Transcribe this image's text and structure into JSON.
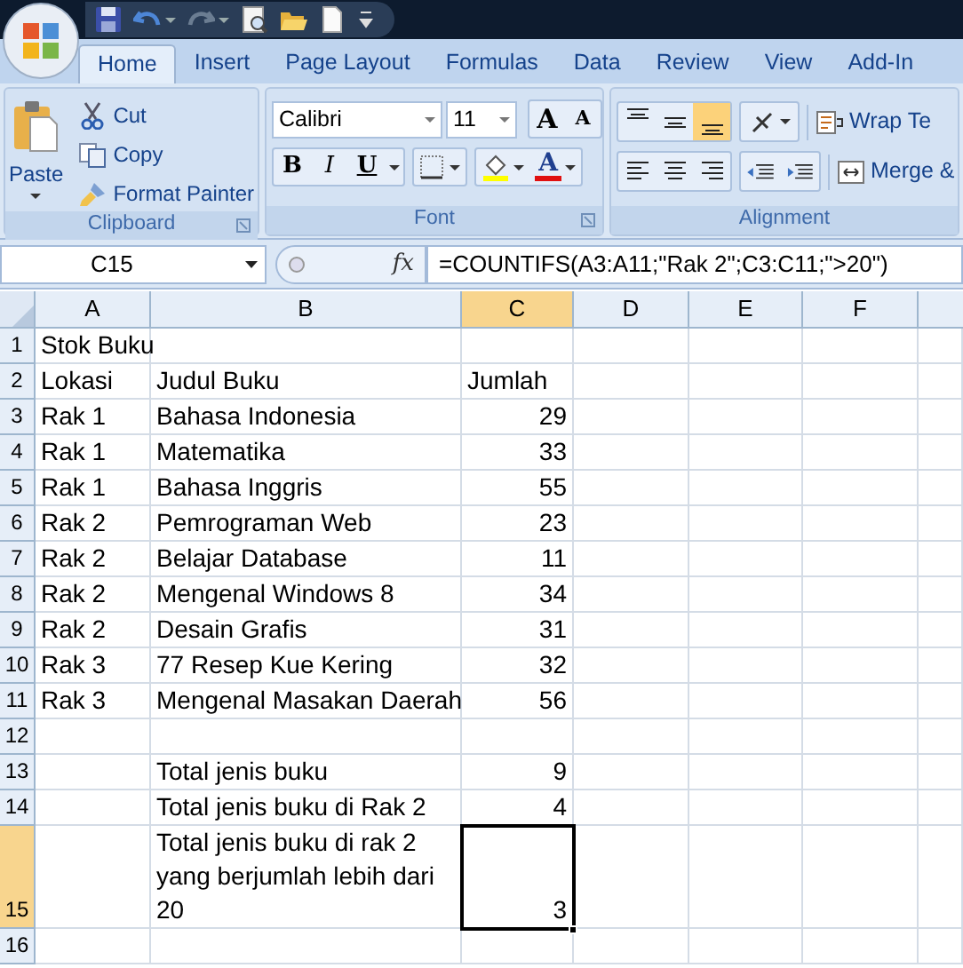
{
  "quick_access": [
    {
      "kind": "save"
    },
    {
      "kind": "undo",
      "dropdown": true
    },
    {
      "kind": "redo",
      "dropdown": true
    },
    {
      "kind": "preview"
    },
    {
      "kind": "open"
    },
    {
      "kind": "new"
    },
    {
      "kind": "customize"
    }
  ],
  "tabs": [
    {
      "label": "Home",
      "selected": true
    },
    {
      "label": "Insert",
      "selected": false
    },
    {
      "label": "Page Layout",
      "selected": false
    },
    {
      "label": "Formulas",
      "selected": false
    },
    {
      "label": "Data",
      "selected": false
    },
    {
      "label": "Review",
      "selected": false
    },
    {
      "label": "View",
      "selected": false
    },
    {
      "label": "Add-In",
      "selected": false
    }
  ],
  "clipboard": {
    "paste": "Paste",
    "items": [
      {
        "kind": "cut",
        "label": "Cut"
      },
      {
        "kind": "copy",
        "label": "Copy"
      },
      {
        "kind": "painter",
        "label": "Format Painter"
      }
    ],
    "label": "Clipboard"
  },
  "font": {
    "name": "Calibri",
    "size": "11",
    "size_buttons": [
      {
        "kind": "grow",
        "glyph": "A"
      },
      {
        "kind": "shrink",
        "glyph": "A"
      }
    ],
    "styles": [
      {
        "kind": "bold",
        "glyph": "B"
      },
      {
        "kind": "italic",
        "glyph": "I"
      },
      {
        "kind": "underline",
        "glyph": "U"
      }
    ],
    "font_color": {
      "glyph": "A"
    },
    "label": "Font"
  },
  "alignment": {
    "vertical": [
      {
        "kind": "top",
        "selected": false
      },
      {
        "kind": "middle",
        "selected": false
      },
      {
        "kind": "bottom",
        "selected": true
      }
    ],
    "horizontal": [
      {
        "kind": "left",
        "selected": false
      },
      {
        "kind": "center",
        "selected": false
      },
      {
        "kind": "right",
        "selected": false
      }
    ],
    "wrap": "Wrap Te",
    "merge": "Merge &",
    "label": "Alignment"
  },
  "formula_bar": {
    "name_box": "C15",
    "fx": "fx",
    "formula": "=COUNTIFS(A3:A11;\"Rak 2\";C3:C11;\">20\")"
  },
  "columns": [
    {
      "label": "A",
      "selected": false
    },
    {
      "label": "B",
      "selected": false
    },
    {
      "label": "C",
      "selected": true
    },
    {
      "label": "D",
      "selected": false
    },
    {
      "label": "E",
      "selected": false
    },
    {
      "label": "F",
      "selected": false
    }
  ],
  "rows": [
    {
      "number": "1",
      "selected": false,
      "a": {
        "text": "Stok Buku"
      }
    },
    {
      "number": "2",
      "selected": false,
      "a": {
        "text": "Lokasi"
      },
      "b": {
        "text": "Judul Buku"
      },
      "c": {
        "text": "Jumlah",
        "kind": "text"
      }
    },
    {
      "number": "3",
      "selected": false,
      "a": {
        "text": "Rak 1"
      },
      "b": {
        "text": "Bahasa Indonesia"
      },
      "c": {
        "text": "29",
        "kind": "number"
      }
    },
    {
      "number": "4",
      "selected": false,
      "a": {
        "text": "Rak 1"
      },
      "b": {
        "text": "Matematika"
      },
      "c": {
        "text": "33",
        "kind": "number"
      }
    },
    {
      "number": "5",
      "selected": false,
      "a": {
        "text": "Rak 1"
      },
      "b": {
        "text": "Bahasa Inggris"
      },
      "c": {
        "text": "55",
        "kind": "number"
      }
    },
    {
      "number": "6",
      "selected": false,
      "a": {
        "text": "Rak 2"
      },
      "b": {
        "text": "Pemrograman Web"
      },
      "c": {
        "text": "23",
        "kind": "number"
      }
    },
    {
      "number": "7",
      "selected": false,
      "a": {
        "text": "Rak 2"
      },
      "b": {
        "text": "Belajar Database"
      },
      "c": {
        "text": "11",
        "kind": "number"
      }
    },
    {
      "number": "8",
      "selected": false,
      "a": {
        "text": "Rak 2"
      },
      "b": {
        "text": "Mengenal Windows 8"
      },
      "c": {
        "text": "34",
        "kind": "number"
      }
    },
    {
      "number": "9",
      "selected": false,
      "a": {
        "text": "Rak 2"
      },
      "b": {
        "text": "Desain Grafis"
      },
      "c": {
        "text": "31",
        "kind": "number"
      }
    },
    {
      "number": "10",
      "selected": false,
      "a": {
        "text": "Rak 3"
      },
      "b": {
        "text": "77 Resep Kue Kering"
      },
      "c": {
        "text": "32",
        "kind": "number"
      }
    },
    {
      "number": "11",
      "selected": false,
      "a": {
        "text": "Rak 3"
      },
      "b": {
        "text": "Mengenal Masakan Daerah"
      },
      "c": {
        "text": "56",
        "kind": "number"
      }
    },
    {
      "number": "12",
      "selected": false
    },
    {
      "number": "13",
      "selected": false,
      "b": {
        "text": "Total jenis buku"
      },
      "c": {
        "text": "9",
        "kind": "number"
      }
    },
    {
      "number": "14",
      "selected": false,
      "b": {
        "text": "Total jenis buku di Rak 2"
      },
      "c": {
        "text": "4",
        "kind": "number"
      }
    },
    {
      "number": "15",
      "selected": true,
      "b": {
        "text": "Total jenis buku di rak 2 yang berjumlah lebih dari 20",
        "wrap": true
      },
      "c": {
        "text": "3",
        "kind": "number",
        "active": true
      }
    },
    {
      "number": "16",
      "selected": false
    }
  ]
}
